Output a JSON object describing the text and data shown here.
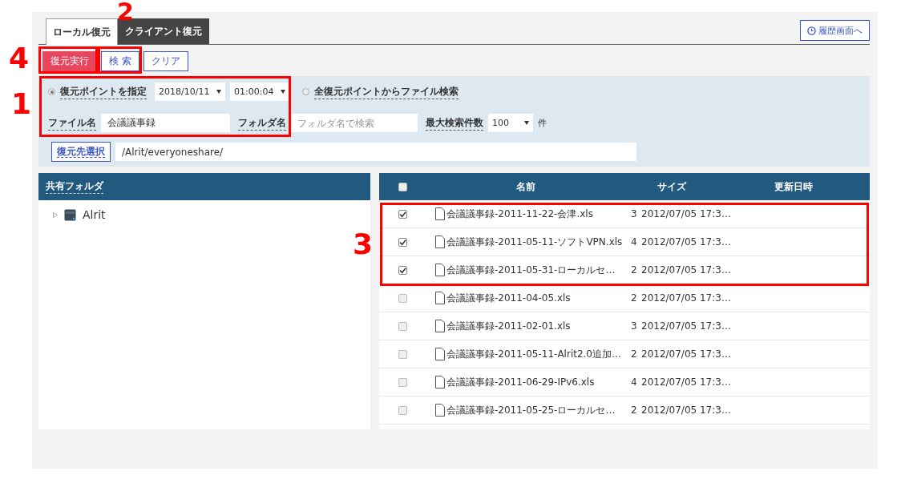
{
  "tabs": [
    {
      "label": "ローカル復元",
      "selected": true
    },
    {
      "label": "クライアント復元",
      "selected": false
    }
  ],
  "history_button": {
    "label": "履歴画面へ"
  },
  "actions": [
    {
      "label": "復元実行",
      "kind": "primary"
    },
    {
      "label": "検 索",
      "kind": "secondary"
    },
    {
      "label": "クリア",
      "kind": "secondary"
    }
  ],
  "filter": {
    "modes": [
      {
        "label": "復元ポイントを指定",
        "selected": true
      },
      {
        "label": "全復元ポイントからファイル検索",
        "selected": false
      }
    ],
    "date": "2018/10/11",
    "time": "01:00:04",
    "file_name": {
      "label": "ファイル名",
      "value": "会議議事録"
    },
    "folder_name": {
      "label": "フォルダ名",
      "placeholder": "フォルダ名で検索"
    },
    "max_results": {
      "label": "最大検索件数",
      "value": "100",
      "unit": "件"
    },
    "destination": {
      "button": "復元先選択",
      "value": "/Alrit/everyoneshare/"
    }
  },
  "folder_panel": {
    "title": "共有フォルダ",
    "tree": [
      {
        "label": "Alrit",
        "expanded": false
      }
    ]
  },
  "file_table": {
    "header_checked": false,
    "columns": [
      "名前",
      "サイズ",
      "更新日時"
    ],
    "rows": [
      {
        "checked": true,
        "name": "会議議事録-2011-11-22-会津.xls",
        "size": "3",
        "date": "2012/07/05 17:3…"
      },
      {
        "checked": true,
        "name": "会議議事録-2011-05-11-ソフトVPN.xls",
        "size": "4",
        "date": "2012/07/05 17:3…"
      },
      {
        "checked": true,
        "name": "会議議事録-2011-05-31-ローカルセ…",
        "size": "2",
        "date": "2012/07/05 17:3…"
      },
      {
        "checked": false,
        "name": "会議議事録-2011-04-05.xls",
        "size": "2",
        "date": "2012/07/05 17:3…"
      },
      {
        "checked": false,
        "name": "会議議事録-2011-02-01.xls",
        "size": "3",
        "date": "2012/07/05 17:3…"
      },
      {
        "checked": false,
        "name": "会議議事録-2011-05-11-Alrit2.0追加…",
        "size": "2",
        "date": "2012/07/05 17:3…"
      },
      {
        "checked": false,
        "name": "会議議事録-2011-06-29-IPv6.xls",
        "size": "4",
        "date": "2012/07/05 17:3…"
      },
      {
        "checked": false,
        "name": "会議議事録-2011-05-25-ローカルセ…",
        "size": "2",
        "date": "2012/07/05 17:3…"
      }
    ]
  },
  "annotations": [
    {
      "label": "1"
    },
    {
      "label": "2"
    },
    {
      "label": "3"
    },
    {
      "label": "4"
    }
  ]
}
